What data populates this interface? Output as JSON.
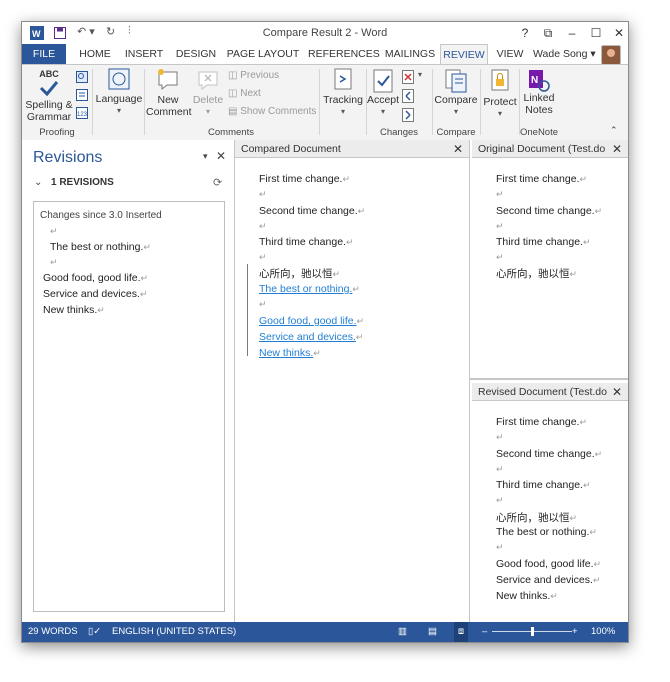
{
  "window": {
    "title": "Compare Result 2 - Word"
  },
  "tabs": {
    "file": "FILE",
    "home": "HOME",
    "insert": "INSERT",
    "design": "DESIGN",
    "page_layout": "PAGE LAYOUT",
    "references": "REFERENCES",
    "mailings": "MAILINGS",
    "review": "REVIEW",
    "view": "VIEW"
  },
  "user": {
    "name": "Wade Song"
  },
  "ribbon": {
    "proofing": {
      "spelling": "Spelling &",
      "grammar": "Grammar",
      "abc": "ABC",
      "group": "Proofing",
      "language": "Language"
    },
    "comments": {
      "new1": "New",
      "new2": "Comment",
      "delete": "Delete",
      "previous": "Previous",
      "next": "Next",
      "show": "Show Comments",
      "group": "Comments"
    },
    "tracking": {
      "label": "Tracking"
    },
    "changes": {
      "accept": "Accept",
      "group": "Changes"
    },
    "compare": {
      "label": "Compare",
      "group": "Compare"
    },
    "protect": {
      "label": "Protect"
    },
    "onenote": {
      "linked1": "Linked",
      "linked2": "Notes",
      "group": "OneNote"
    }
  },
  "revisions_pane": {
    "title": "Revisions",
    "count": "1 REVISIONS",
    "entry_header": "Changes since 3.0 Inserted",
    "lines": [
      "The best or nothing.",
      "Good food, good life.",
      "Service and devices.",
      "New thinks."
    ]
  },
  "compared": {
    "header": "Compared Document",
    "lines": [
      "First time change.",
      "Second time change.",
      "Third time change.",
      "心所向，驰以恒"
    ],
    "inserted": [
      "The best or nothing.",
      "Good food, good life.",
      "Service and devices.",
      "New thinks."
    ]
  },
  "original": {
    "header": "Original Document (Test.do",
    "lines": [
      "First time change.",
      "Second time change.",
      "Third time change.",
      "心所向，驰以恒"
    ]
  },
  "revised": {
    "header": "Revised Document (Test.do",
    "lines": [
      "First time change.",
      "Second time change.",
      "Third time change.",
      "心所向，驰以恒",
      "The best or nothing.",
      "Good food, good life.",
      "Service and devices.",
      "New thinks."
    ]
  },
  "status": {
    "words": "29 WORDS",
    "language": "ENGLISH (UNITED STATES)",
    "zoom": "100%",
    "zoom_level": 0.5
  },
  "para_mark": "↵",
  "colors": {
    "accent": "#2b579a",
    "inserted": "#1f7ed1"
  }
}
